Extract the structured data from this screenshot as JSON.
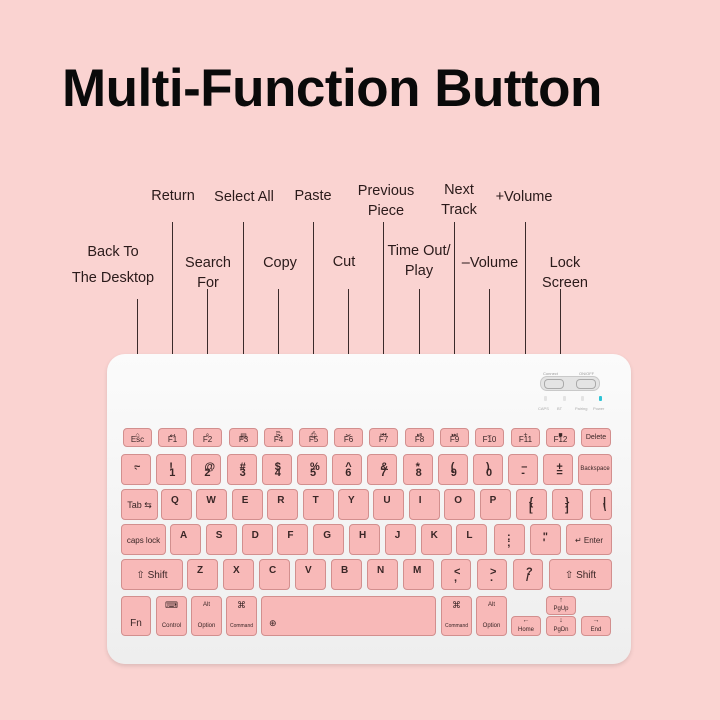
{
  "title": "Multi-Function Button",
  "callouts": [
    {
      "id": "back",
      "lines": [
        "Back To",
        "The Desktop"
      ],
      "target": "Esc"
    },
    {
      "id": "return",
      "lines": [
        "Return"
      ],
      "target": "F1"
    },
    {
      "id": "search",
      "lines": [
        "Search",
        "For"
      ],
      "target": "F2"
    },
    {
      "id": "selectall",
      "lines": [
        "Select All"
      ],
      "target": "F3"
    },
    {
      "id": "copy",
      "lines": [
        "Copy"
      ],
      "target": "F4"
    },
    {
      "id": "paste",
      "lines": [
        "Paste"
      ],
      "target": "F5"
    },
    {
      "id": "cut",
      "lines": [
        "Cut"
      ],
      "target": "F6"
    },
    {
      "id": "previous",
      "lines": [
        "Previous",
        "Piece"
      ],
      "target": "F7"
    },
    {
      "id": "timeout",
      "lines": [
        "Time Out/",
        "Play"
      ],
      "target": "F8"
    },
    {
      "id": "next",
      "lines": [
        "Next",
        "Track"
      ],
      "target": "F9"
    },
    {
      "id": "voldown",
      "lines": [
        "–Volume"
      ],
      "target": "F10"
    },
    {
      "id": "volup",
      "lines": [
        "+Volume"
      ],
      "target": "F11"
    },
    {
      "id": "lock",
      "lines": [
        "Lock",
        "Screen"
      ],
      "target": "F12"
    }
  ],
  "keyboard": {
    "indicators": {
      "switch_left": "Connect",
      "switch_right": "ON/OFF",
      "leds": [
        "CAPS",
        "BT",
        "Pairing",
        "Power"
      ],
      "power_led_color": "#2ec4d6"
    },
    "fn_row": [
      {
        "name": "Esc",
        "icon": "⌂"
      },
      {
        "name": "F1",
        "icon": "↩"
      },
      {
        "name": "F2",
        "icon": "⌕"
      },
      {
        "name": "F3",
        "icon": "▤"
      },
      {
        "name": "F4",
        "icon": "⎘"
      },
      {
        "name": "F5",
        "icon": "⎙"
      },
      {
        "name": "F6",
        "icon": "✂"
      },
      {
        "name": "F7",
        "icon": "⏮"
      },
      {
        "name": "F8",
        "icon": "⏯"
      },
      {
        "name": "F9",
        "icon": "⏭"
      },
      {
        "name": "F10",
        "icon": "–"
      },
      {
        "name": "F11",
        "icon": "+"
      },
      {
        "name": "F12",
        "icon": "■"
      },
      {
        "name": "Delete",
        "icon": ""
      }
    ],
    "number_row": [
      {
        "up": "~",
        "dn": "`"
      },
      {
        "up": "!",
        "dn": "1"
      },
      {
        "up": "@",
        "dn": "2"
      },
      {
        "up": "#",
        "dn": "3"
      },
      {
        "up": "$",
        "dn": "4"
      },
      {
        "up": "%",
        "dn": "5"
      },
      {
        "up": "^",
        "dn": "6"
      },
      {
        "up": "&",
        "dn": "7"
      },
      {
        "up": "*",
        "dn": "8"
      },
      {
        "up": "(",
        "dn": "9"
      },
      {
        "up": ")",
        "dn": "0"
      },
      {
        "up": "–",
        "dn": "-"
      },
      {
        "up": "+",
        "dn": "="
      }
    ],
    "backspace": "Backspace",
    "tab": "Tab",
    "qwerty_row": [
      "Q",
      "W",
      "E",
      "R",
      "T",
      "Y",
      "U",
      "I",
      "O",
      "P"
    ],
    "bracket_keys": [
      {
        "up": "{",
        "dn": "["
      },
      {
        "up": "}",
        "dn": "]"
      },
      {
        "up": "|",
        "dn": "\\"
      }
    ],
    "caps": "caps lock",
    "home_row": [
      "A",
      "S",
      "D",
      "F",
      "G",
      "H",
      "J",
      "K",
      "L"
    ],
    "home_punct": [
      {
        "up": ":",
        "dn": ";"
      },
      {
        "up": "\"",
        "dn": "'"
      }
    ],
    "enter": "Enter",
    "shift": "Shift",
    "bottom_letters": [
      "Z",
      "X",
      "C",
      "V",
      "B",
      "N",
      "M"
    ],
    "bottom_punct": [
      {
        "up": "<",
        "dn": ","
      },
      {
        "up": ">",
        "dn": "."
      },
      {
        "up": "?",
        "dn": "/"
      }
    ],
    "fn": "Fn",
    "control": "Control",
    "alt": "Alt",
    "option": "Option",
    "command": "Command",
    "command_icon": "⌘",
    "globe_icon": "⊕",
    "home": "Home",
    "pgup": "PgUp",
    "pgdn": "PgDn",
    "end": "End"
  }
}
